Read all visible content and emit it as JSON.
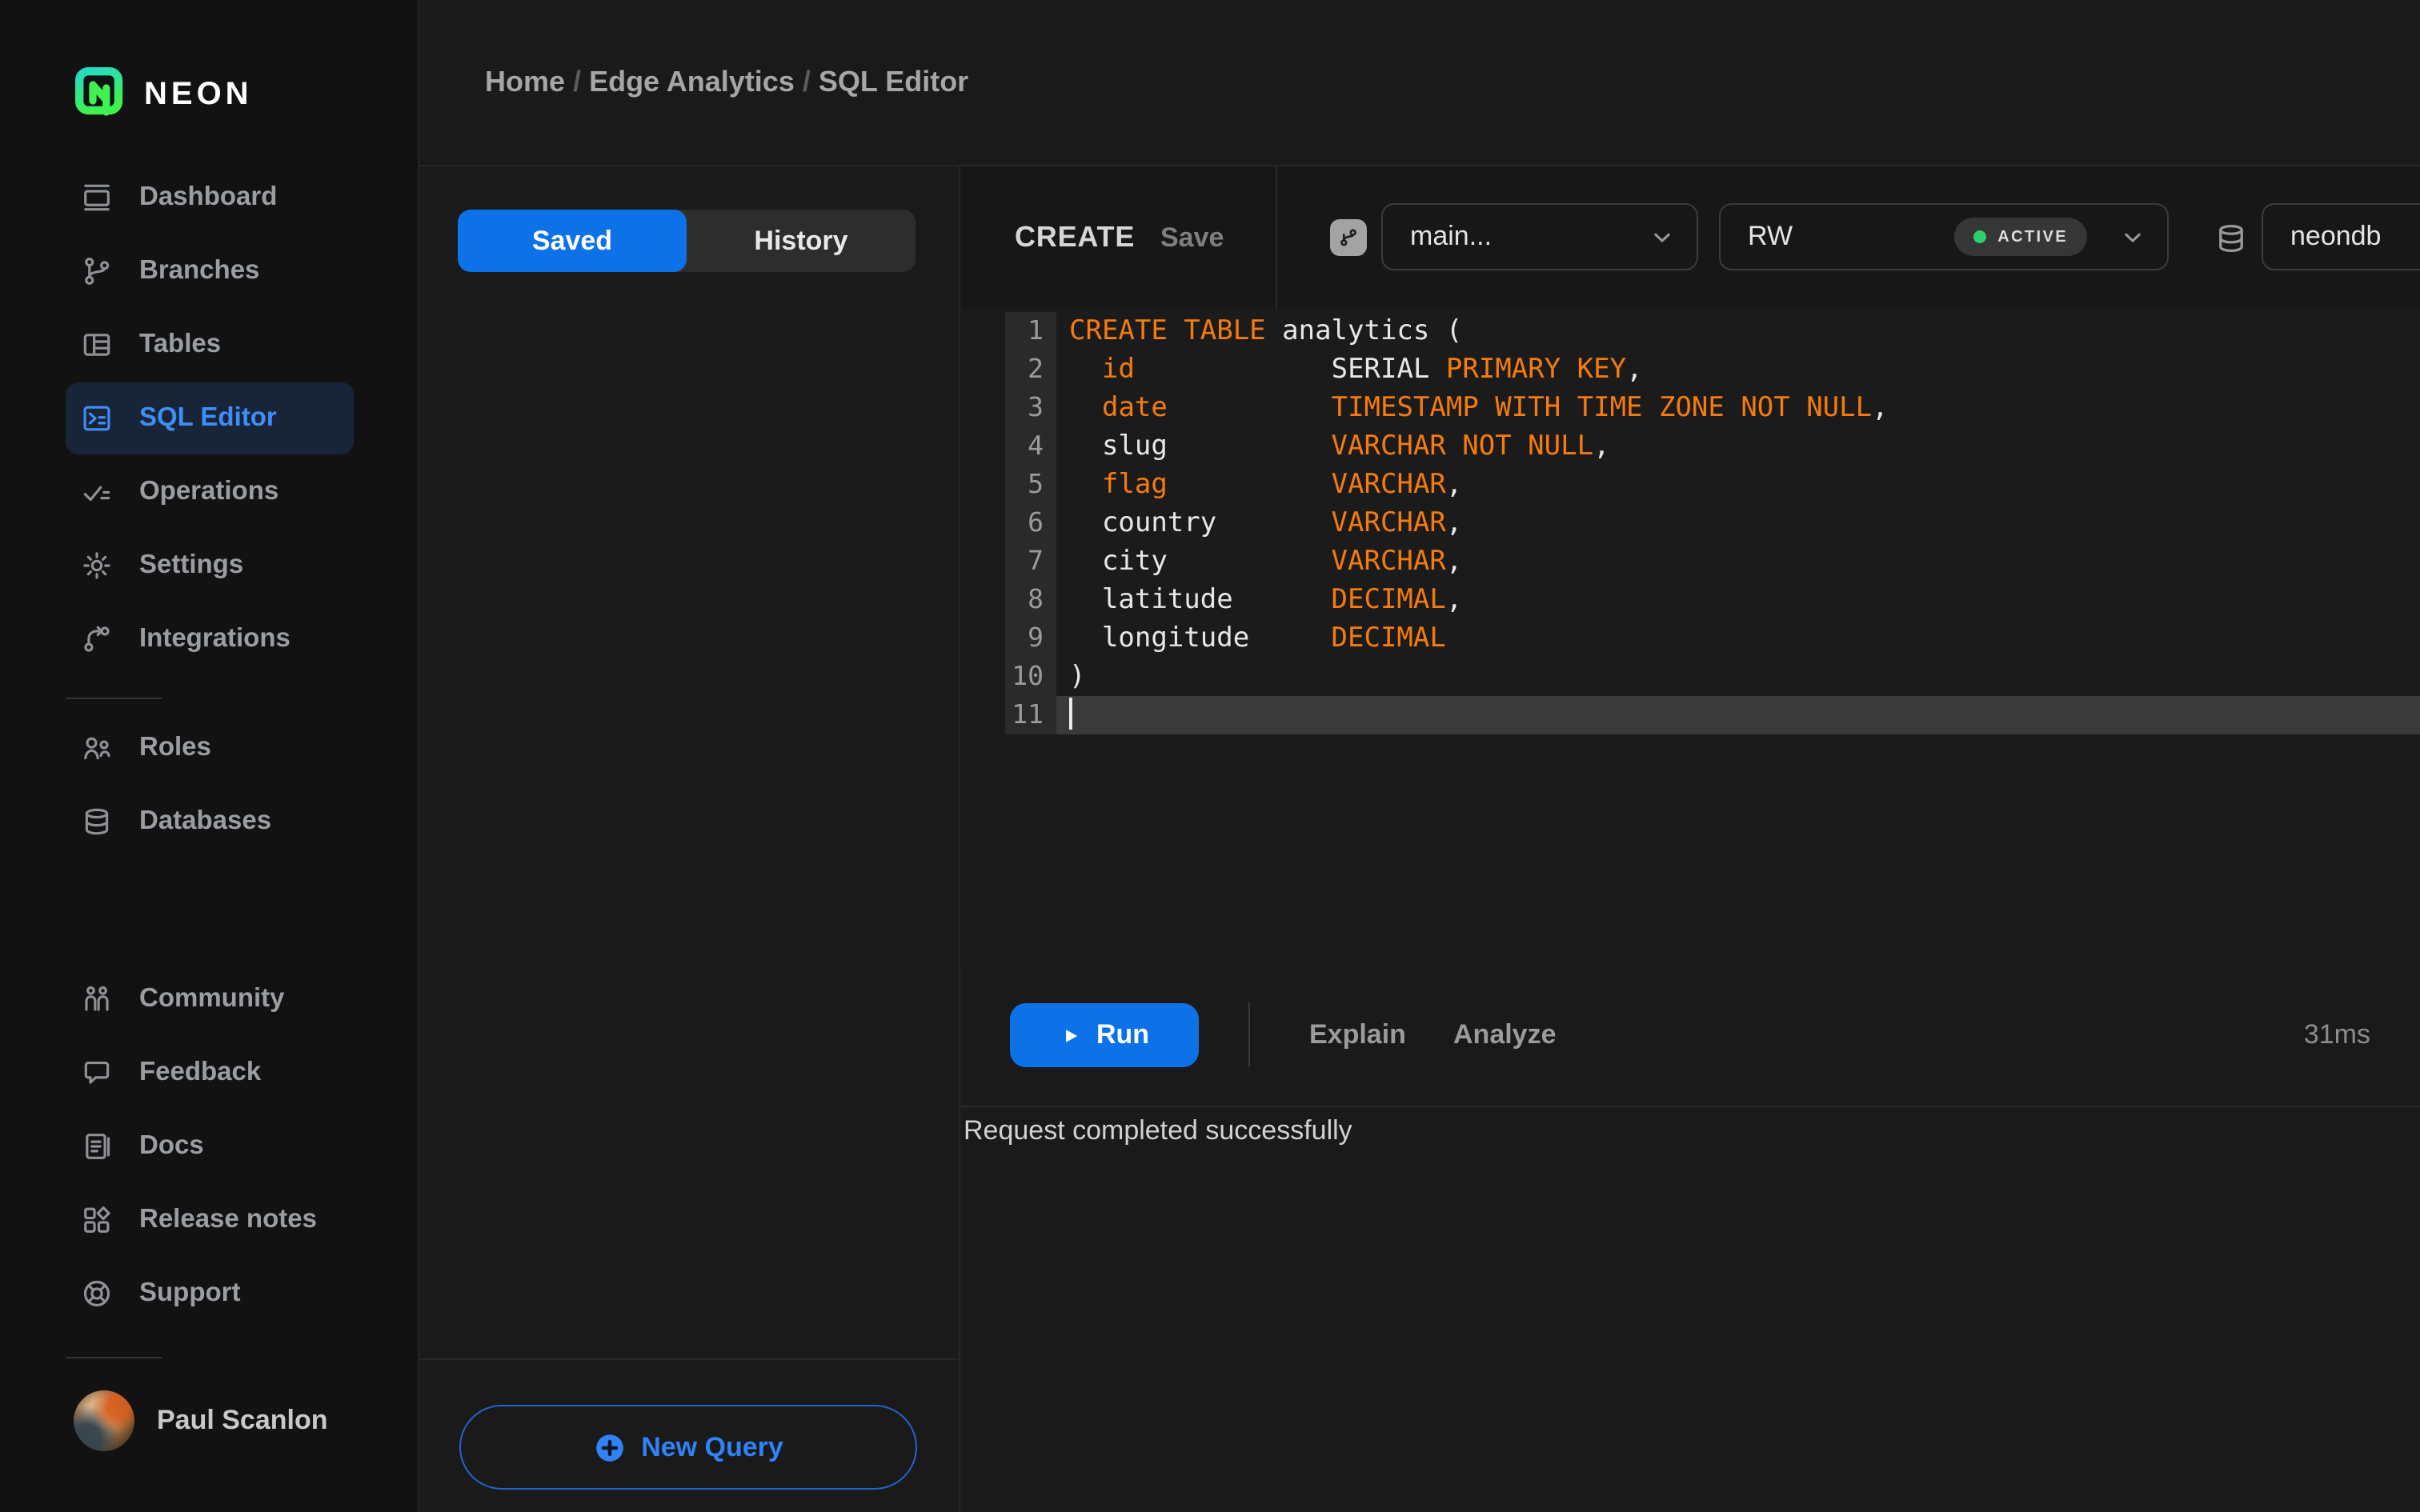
{
  "brand": {
    "name": "NEON"
  },
  "breadcrumb": {
    "separator": "/",
    "items": [
      "Home",
      "Edge Analytics",
      "SQL Editor"
    ]
  },
  "sidebar": {
    "main_items": [
      {
        "label": "Dashboard",
        "icon": "dashboard",
        "active": false
      },
      {
        "label": "Branches",
        "icon": "branches",
        "active": false
      },
      {
        "label": "Tables",
        "icon": "tables",
        "active": false
      },
      {
        "label": "SQL Editor",
        "icon": "sql-editor",
        "active": true
      },
      {
        "label": "Operations",
        "icon": "operations",
        "active": false
      },
      {
        "label": "Settings",
        "icon": "settings",
        "active": false
      },
      {
        "label": "Integrations",
        "icon": "integrations",
        "active": false
      }
    ],
    "secondary_items": [
      {
        "label": "Roles",
        "icon": "roles",
        "active": false
      },
      {
        "label": "Databases",
        "icon": "databases",
        "active": false
      }
    ],
    "support_items": [
      {
        "label": "Community",
        "icon": "community",
        "active": false
      },
      {
        "label": "Feedback",
        "icon": "feedback",
        "active": false
      },
      {
        "label": "Docs",
        "icon": "docs",
        "active": false
      },
      {
        "label": "Release notes",
        "icon": "release-notes",
        "active": false
      },
      {
        "label": "Support",
        "icon": "support",
        "active": false
      }
    ],
    "user": {
      "name": "Paul Scanlon"
    }
  },
  "queries_panel": {
    "tabs": [
      {
        "label": "Saved",
        "active": true
      },
      {
        "label": "History",
        "active": false
      }
    ],
    "new_query_label": "New Query"
  },
  "editor_header": {
    "title": "CREATE",
    "save_label": "Save",
    "branch": {
      "value": "main..."
    },
    "compute": {
      "value": "RW",
      "status": "ACTIVE"
    },
    "database": {
      "value": "neondb"
    }
  },
  "editor": {
    "active_line": 11,
    "lines": [
      {
        "num": 1,
        "tokens": [
          [
            "CREATE TABLE",
            "kw"
          ],
          [
            " analytics (",
            "pl"
          ]
        ]
      },
      {
        "num": 2,
        "tokens": [
          [
            "  ",
            "pl"
          ],
          [
            "id",
            "kw"
          ],
          [
            "            ",
            "pl"
          ],
          [
            "SERIAL ",
            "pl"
          ],
          [
            "PRIMARY KEY",
            "kw"
          ],
          [
            ",",
            "pl"
          ]
        ]
      },
      {
        "num": 3,
        "tokens": [
          [
            "  ",
            "pl"
          ],
          [
            "date",
            "kw"
          ],
          [
            "          ",
            "pl"
          ],
          [
            "TIMESTAMP WITH TIME ZONE NOT NULL",
            "kw"
          ],
          [
            ",",
            "pl"
          ]
        ]
      },
      {
        "num": 4,
        "tokens": [
          [
            "  slug          ",
            "pl"
          ],
          [
            "VARCHAR NOT NULL",
            "kw"
          ],
          [
            ",",
            "pl"
          ]
        ]
      },
      {
        "num": 5,
        "tokens": [
          [
            "  ",
            "pl"
          ],
          [
            "flag",
            "kw"
          ],
          [
            "          ",
            "pl"
          ],
          [
            "VARCHAR",
            "kw"
          ],
          [
            ",",
            "pl"
          ]
        ]
      },
      {
        "num": 6,
        "tokens": [
          [
            "  country       ",
            "pl"
          ],
          [
            "VARCHAR",
            "kw"
          ],
          [
            ",",
            "pl"
          ]
        ]
      },
      {
        "num": 7,
        "tokens": [
          [
            "  city          ",
            "pl"
          ],
          [
            "VARCHAR",
            "kw"
          ],
          [
            ",",
            "pl"
          ]
        ]
      },
      {
        "num": 8,
        "tokens": [
          [
            "  latitude      ",
            "pl"
          ],
          [
            "DECIMAL",
            "kw"
          ],
          [
            ",",
            "pl"
          ]
        ]
      },
      {
        "num": 9,
        "tokens": [
          [
            "  longitude     ",
            "pl"
          ],
          [
            "DECIMAL",
            "kw"
          ]
        ]
      },
      {
        "num": 10,
        "tokens": [
          [
            ")",
            "pl"
          ]
        ]
      },
      {
        "num": 11,
        "tokens": []
      }
    ]
  },
  "run_bar": {
    "run_label": "Run",
    "explain_label": "Explain",
    "analyze_label": "Analyze",
    "duration": "31ms"
  },
  "result": {
    "message": "Request completed successfully"
  },
  "colors": {
    "accent_blue": "#0d72e8",
    "link_blue": "#3f8ef7",
    "keyword_orange": "#f57b0e",
    "status_green": "#2bd06a",
    "active_item_bg": "#182539"
  }
}
